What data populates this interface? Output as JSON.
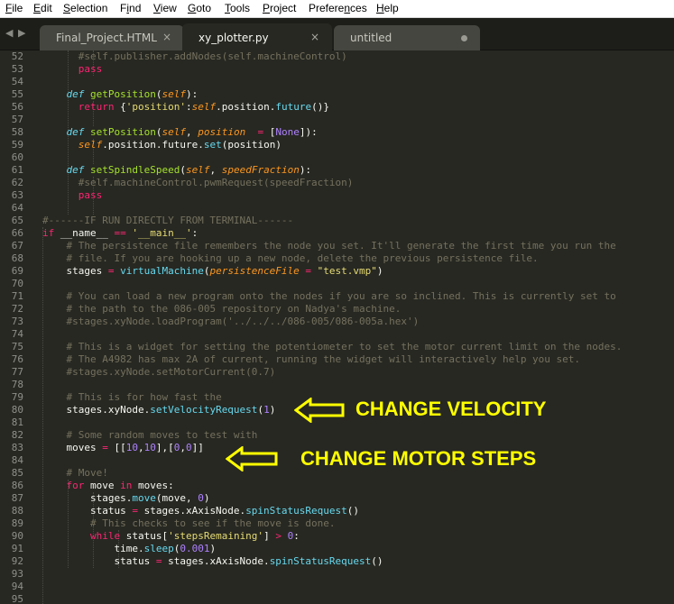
{
  "menu": {
    "items": [
      "File",
      "Edit",
      "Selection",
      "Find",
      "View",
      "Goto",
      "Tools",
      "Project",
      "Preferences",
      "Help"
    ],
    "underline": [
      "F",
      "E",
      "S",
      "i",
      "V",
      "G",
      "T",
      "P",
      "n",
      "H"
    ]
  },
  "tabs": [
    {
      "title": "Final_Project.HTML",
      "close": "×",
      "active": false,
      "dirty": false
    },
    {
      "title": "xy_plotter.py",
      "close": "×",
      "active": true,
      "dirty": false
    },
    {
      "title": "untitled",
      "close": "",
      "active": false,
      "dirty": true
    }
  ],
  "nav": {
    "back": "◀",
    "forward": "▶"
  },
  "colors": {
    "background": "#272822",
    "keyword": "#f92672",
    "def": "#66d9ef",
    "function": "#a6e22e",
    "self": "#fd971f",
    "string": "#e6db74",
    "number": "#ae81ff",
    "comment": "#75715e",
    "annotation": "#ffff00"
  },
  "editor": {
    "lines": [
      {
        "n": "52",
        "s": [
          [
            "      "
          ],
          [
            "#self.publisher.addNodes(self.machineControl)",
            "cm"
          ]
        ]
      },
      {
        "n": "53",
        "s": [
          [
            "      "
          ],
          [
            "pass",
            "kw"
          ]
        ]
      },
      {
        "n": "54",
        "s": []
      },
      {
        "n": "55",
        "s": [
          [
            "    "
          ],
          [
            "def",
            "df"
          ],
          [
            " "
          ],
          [
            "getPosition",
            "fn"
          ],
          [
            "("
          ],
          [
            "self",
            "sf"
          ],
          [
            "):"
          ]
        ]
      },
      {
        "n": "56",
        "s": [
          [
            "      "
          ],
          [
            "return",
            "kw"
          ],
          [
            " {"
          ],
          [
            "'position'",
            "st"
          ],
          [
            ":"
          ],
          [
            "self",
            "sf"
          ],
          [
            ".position."
          ],
          [
            "future",
            "cb"
          ],
          [
            "()}"
          ]
        ]
      },
      {
        "n": "57",
        "s": []
      },
      {
        "n": "58",
        "s": [
          [
            "    "
          ],
          [
            "def",
            "df"
          ],
          [
            " "
          ],
          [
            "setPosition",
            "fn"
          ],
          [
            "("
          ],
          [
            "self",
            "sf"
          ],
          [
            ", "
          ],
          [
            "position",
            "sf"
          ],
          [
            "  "
          ],
          [
            "=",
            "kw"
          ],
          [
            " ["
          ],
          [
            "None",
            "nm"
          ],
          [
            "]):"
          ]
        ]
      },
      {
        "n": "59",
        "s": [
          [
            "      "
          ],
          [
            "self",
            "sf"
          ],
          [
            ".position.future."
          ],
          [
            "set",
            "cb"
          ],
          [
            "(position)"
          ]
        ]
      },
      {
        "n": "60",
        "s": []
      },
      {
        "n": "61",
        "s": [
          [
            "    "
          ],
          [
            "def",
            "df"
          ],
          [
            " "
          ],
          [
            "setSpindleSpeed",
            "fn"
          ],
          [
            "("
          ],
          [
            "self",
            "sf"
          ],
          [
            ", "
          ],
          [
            "speedFraction",
            "sf"
          ],
          [
            "):"
          ]
        ]
      },
      {
        "n": "62",
        "s": [
          [
            "      "
          ],
          [
            "#self.machineControl.pwmRequest(speedFraction)",
            "cm"
          ]
        ]
      },
      {
        "n": "63",
        "s": [
          [
            "      "
          ],
          [
            "pass",
            "kw"
          ]
        ]
      },
      {
        "n": "64",
        "s": []
      },
      {
        "n": "65",
        "s": [
          [
            "#------IF RUN DIRECTLY FROM TERMINAL------",
            "cm"
          ]
        ]
      },
      {
        "n": "66",
        "s": [
          [
            "if",
            "kw"
          ],
          [
            " __name__ "
          ],
          [
            "==",
            "kw"
          ],
          [
            " "
          ],
          [
            "'__main__'",
            "st"
          ],
          [
            ":"
          ]
        ]
      },
      {
        "n": "67",
        "s": [
          [
            "    "
          ],
          [
            "# The persistence file remembers the node you set. It'll generate the first time you run the",
            "cm"
          ]
        ]
      },
      {
        "n": "68",
        "s": [
          [
            "    "
          ],
          [
            "# file. If you are hooking up a new node, delete the previous persistence file.",
            "cm"
          ]
        ]
      },
      {
        "n": "69",
        "s": [
          [
            "    stages "
          ],
          [
            "=",
            "kw"
          ],
          [
            " "
          ],
          [
            "virtualMachine",
            "cb"
          ],
          [
            "("
          ],
          [
            "persistenceFile",
            "sf"
          ],
          [
            " "
          ],
          [
            "=",
            "kw"
          ],
          [
            " "
          ],
          [
            "\"test.vmp\"",
            "st"
          ],
          [
            ")"
          ]
        ]
      },
      {
        "n": "70",
        "s": []
      },
      {
        "n": "71",
        "s": [
          [
            "    "
          ],
          [
            "# You can load a new program onto the nodes if you are so inclined. This is currently set to",
            "cm"
          ]
        ]
      },
      {
        "n": "72",
        "s": [
          [
            "    "
          ],
          [
            "# the path to the 086-005 repository on Nadya's machine.",
            "cm"
          ]
        ]
      },
      {
        "n": "73",
        "s": [
          [
            "    "
          ],
          [
            "#stages.xyNode.loadProgram('../../../086-005/086-005a.hex')",
            "cm"
          ]
        ]
      },
      {
        "n": "74",
        "s": []
      },
      {
        "n": "75",
        "s": [
          [
            "    "
          ],
          [
            "# This is a widget for setting the potentiometer to set the motor current limit on the nodes.",
            "cm"
          ]
        ]
      },
      {
        "n": "76",
        "s": [
          [
            "    "
          ],
          [
            "# The A4982 has max 2A of current, running the widget will interactively help you set.",
            "cm"
          ]
        ]
      },
      {
        "n": "77",
        "s": [
          [
            "    "
          ],
          [
            "#stages.xyNode.setMotorCurrent(0.7)",
            "cm"
          ]
        ]
      },
      {
        "n": "78",
        "s": []
      },
      {
        "n": "79",
        "s": [
          [
            "    "
          ],
          [
            "# This is for how fast the",
            "cm"
          ]
        ]
      },
      {
        "n": "80",
        "s": [
          [
            "    stages.xyNode."
          ],
          [
            "setVelocityRequest",
            "cb"
          ],
          [
            "("
          ],
          [
            "1",
            "nm"
          ],
          [
            ")"
          ]
        ]
      },
      {
        "n": "81",
        "s": []
      },
      {
        "n": "82",
        "s": [
          [
            "    "
          ],
          [
            "# Some random moves to test with",
            "cm"
          ]
        ]
      },
      {
        "n": "83",
        "s": [
          [
            "    moves "
          ],
          [
            "=",
            "kw"
          ],
          [
            " [["
          ],
          [
            "10",
            "nm"
          ],
          [
            ","
          ],
          [
            "10",
            "nm"
          ],
          [
            "],["
          ],
          [
            "0",
            "nm"
          ],
          [
            ","
          ],
          [
            "0",
            "nm"
          ],
          [
            "]]"
          ]
        ]
      },
      {
        "n": "84",
        "s": []
      },
      {
        "n": "85",
        "s": [
          [
            "    "
          ],
          [
            "# Move!",
            "cm"
          ]
        ]
      },
      {
        "n": "86",
        "s": [
          [
            "    "
          ],
          [
            "for",
            "kw"
          ],
          [
            " move "
          ],
          [
            "in",
            "kw"
          ],
          [
            " moves:"
          ]
        ]
      },
      {
        "n": "87",
        "s": [
          [
            "        stages."
          ],
          [
            "move",
            "cb"
          ],
          [
            "(move, "
          ],
          [
            "0",
            "nm"
          ],
          [
            ")"
          ]
        ]
      },
      {
        "n": "88",
        "s": [
          [
            "        status "
          ],
          [
            "=",
            "kw"
          ],
          [
            " stages.xAxisNode."
          ],
          [
            "spinStatusRequest",
            "cb"
          ],
          [
            "()"
          ]
        ]
      },
      {
        "n": "89",
        "s": [
          [
            "        "
          ],
          [
            "# This checks to see if the move is done.",
            "cm"
          ]
        ]
      },
      {
        "n": "90",
        "s": [
          [
            "        "
          ],
          [
            "while",
            "kw"
          ],
          [
            " status["
          ],
          [
            "'stepsRemaining'",
            "st"
          ],
          [
            "] "
          ],
          [
            ">",
            "kw"
          ],
          [
            " "
          ],
          [
            "0",
            "nm"
          ],
          [
            ":"
          ]
        ]
      },
      {
        "n": "91",
        "s": [
          [
            "            time."
          ],
          [
            "sleep",
            "cb"
          ],
          [
            "("
          ],
          [
            "0.001",
            "nm"
          ],
          [
            ")"
          ]
        ]
      },
      {
        "n": "92",
        "s": [
          [
            "            status "
          ],
          [
            "=",
            "kw"
          ],
          [
            " stages.xAxisNode."
          ],
          [
            "spinStatusRequest",
            "cb"
          ],
          [
            "()"
          ]
        ]
      },
      {
        "n": "93",
        "s": []
      },
      {
        "n": "94",
        "s": []
      },
      {
        "n": "95",
        "s": []
      }
    ]
  },
  "annotations": {
    "velocity": "CHANGE VELOCITY",
    "steps": "CHANGE MOTOR STEPS"
  }
}
